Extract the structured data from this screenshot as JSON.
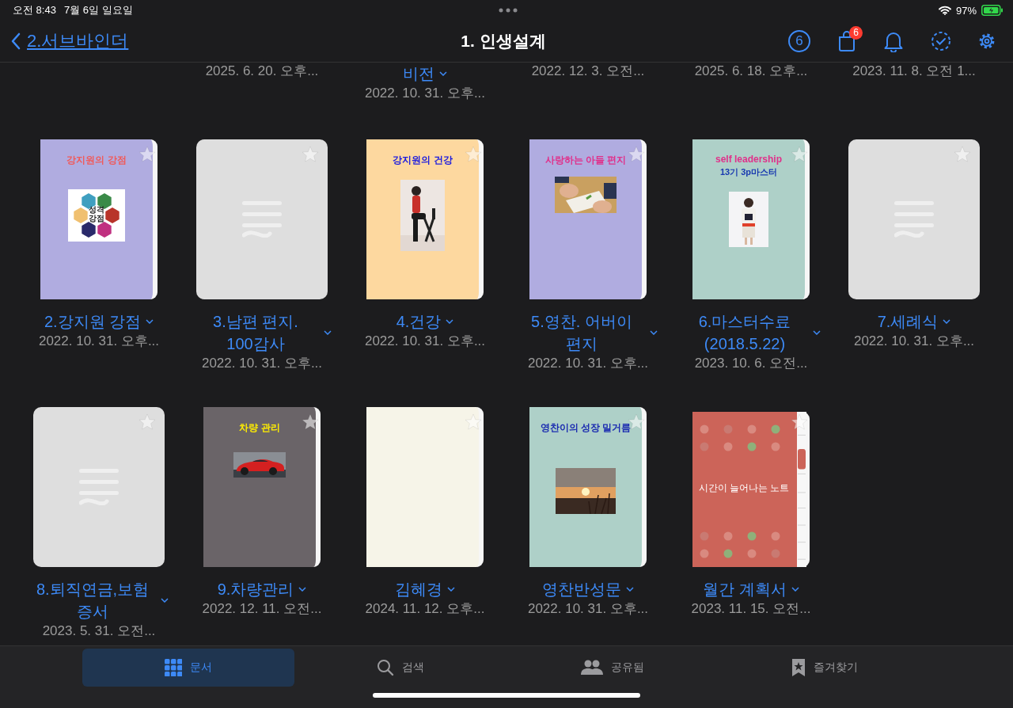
{
  "status_bar": {
    "time": "오전 8:43",
    "date": "7월 6일 일요일",
    "battery": "97%"
  },
  "nav": {
    "back": "2.서브바인더",
    "title": "1. 인생설계",
    "count": "6",
    "badge": "6"
  },
  "partial_row": [
    {
      "date": "2025. 6. 20. 오후..."
    },
    {
      "title": "비전",
      "date": "2022. 10. 31. 오후..."
    },
    {
      "date": "2022. 12. 3. 오전..."
    },
    {
      "date": "2025. 6. 18. 오후..."
    },
    {
      "date": "2023. 11. 8. 오전 1..."
    }
  ],
  "documents": [
    {
      "kind": "cover",
      "title": "2.강지원 강점",
      "date": "2022. 10. 31. 오후...",
      "starred": false,
      "cover": {
        "color": "#b0ace0",
        "heading": "강지원의 강점",
        "art_text": "성격 강점"
      }
    },
    {
      "kind": "blank",
      "title": "3.남편 편지. 100감사",
      "date": "2022. 10. 31. 오후...",
      "starred": false
    },
    {
      "kind": "cover",
      "title": "4.건강",
      "date": "2022. 10. 31. 오후...",
      "starred": false,
      "cover": {
        "color": "#fdd89f",
        "heading": "강지원의 건강"
      }
    },
    {
      "kind": "cover",
      "title": "5.영찬. 어버이 편지",
      "date": "2022. 10. 31. 오후...",
      "starred": false,
      "cover": {
        "color": "#b0ace0",
        "heading": "사랑하는 아들 편지"
      }
    },
    {
      "kind": "cover",
      "title": "6.마스터수료(2018.5.22)",
      "date": "2023. 10. 6. 오전...",
      "starred": false,
      "cover": {
        "color": "#aed0c8",
        "heading": "self leadership",
        "subheading": "13기 3p마스터"
      }
    },
    {
      "kind": "blank",
      "title": "7.세례식",
      "date": "2022. 10. 31. 오후...",
      "starred": false
    },
    {
      "kind": "blank",
      "title": "8.퇴직연금,보험 증서",
      "date": "2023. 5. 31. 오전...",
      "starred": false
    },
    {
      "kind": "cover",
      "title": "9.차량관리",
      "date": "2022. 12. 11. 오전...",
      "starred": false,
      "cover": {
        "color": "#6a6468",
        "heading": "차량 관리"
      }
    },
    {
      "kind": "plain",
      "title": "김혜경",
      "date": "2024. 11. 12. 오후...",
      "starred": false,
      "cover": {
        "color": "#f6f4e8"
      }
    },
    {
      "kind": "cover",
      "title": "영찬반성문",
      "date": "2022. 10. 31. 오후...",
      "starred": false,
      "cover": {
        "color": "#aed0c8",
        "heading": "영찬이의 성장 밀거름"
      }
    },
    {
      "kind": "planner",
      "title": "월간 계획서",
      "date": "2023. 11. 15. 오전...",
      "starred": false,
      "cover": {
        "color": "#cc6459",
        "heading": "시간이 늘어나는 노트"
      }
    }
  ],
  "tabs": [
    {
      "kind": "grid",
      "label": "문서",
      "selected": true
    },
    {
      "kind": "search",
      "label": "검색",
      "selected": false
    },
    {
      "kind": "people",
      "label": "공유됨",
      "selected": false
    },
    {
      "kind": "bookmark",
      "label": "즐겨찾기",
      "selected": false
    }
  ]
}
